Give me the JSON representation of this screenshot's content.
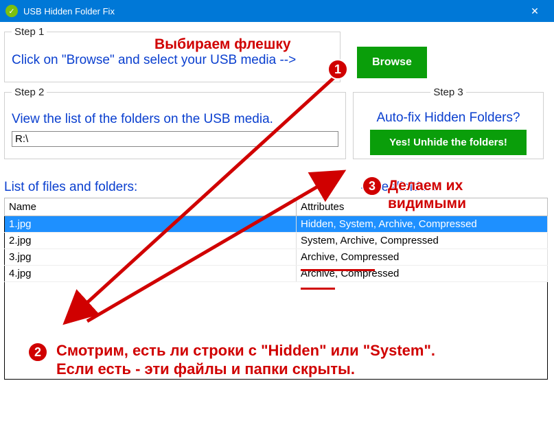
{
  "window": {
    "title": "USB Hidden Folder Fix"
  },
  "step1": {
    "legend": "Step 1",
    "instruction": "Click on \"Browse\" and select your USB media -->",
    "browse_label": "Browse"
  },
  "step2": {
    "legend": "Step 2",
    "instruction": "View the list of the folders on the USB media.",
    "path_value": "R:\\"
  },
  "step3": {
    "legend": "Step 3",
    "question": "Auto-fix Hidden Folders?",
    "fix_label": "Yes! Unhide the folders!"
  },
  "list": {
    "label": "List of files and folders:",
    "count_label": "4 files/folders",
    "columns": {
      "name": "Name",
      "attributes": "Attributes"
    },
    "rows": [
      {
        "name": "1.jpg",
        "attributes": "Hidden, System, Archive, Compressed",
        "selected": true
      },
      {
        "name": "2.jpg",
        "attributes": "System, Archive, Compressed",
        "selected": false
      },
      {
        "name": "3.jpg",
        "attributes": "Archive, Compressed",
        "selected": false
      },
      {
        "name": "4.jpg",
        "attributes": "Archive, Compressed",
        "selected": false
      }
    ]
  },
  "annotations": {
    "a1_text": "Выбираем флешку",
    "a2_line1": "Смотрим, есть ли строки с \"Hidden\" или \"System\".",
    "a2_line2": "Если есть - эти файлы и папки скрыты.",
    "a3_line1": "Делаем их",
    "a3_line2": "видимыми",
    "badge1": "1",
    "badge2": "2",
    "badge3": "3"
  }
}
